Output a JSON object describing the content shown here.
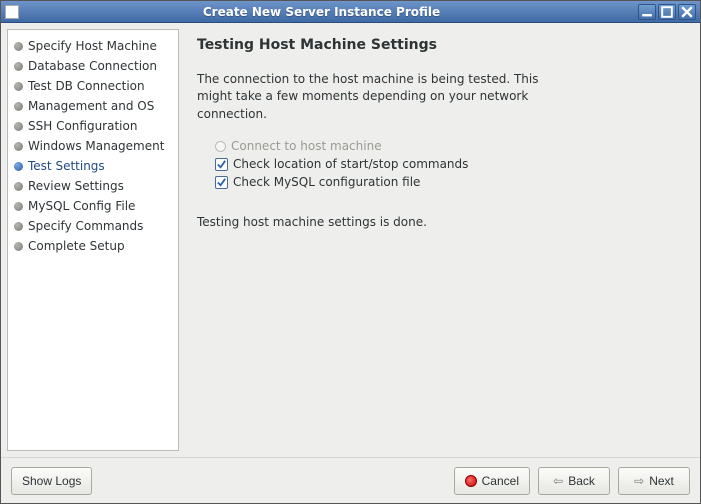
{
  "window": {
    "title": "Create New Server Instance Profile"
  },
  "sidebar": {
    "items": [
      {
        "label": "Specify Host Machine",
        "active": false
      },
      {
        "label": "Database Connection",
        "active": false
      },
      {
        "label": "Test DB Connection",
        "active": false
      },
      {
        "label": "Management and OS",
        "active": false
      },
      {
        "label": "SSH Configuration",
        "active": false
      },
      {
        "label": "Windows Management",
        "active": false
      },
      {
        "label": "Test Settings",
        "active": true
      },
      {
        "label": "Review Settings",
        "active": false
      },
      {
        "label": "MySQL Config File",
        "active": false
      },
      {
        "label": "Specify Commands",
        "active": false
      },
      {
        "label": "Complete Setup",
        "active": false
      }
    ]
  },
  "main": {
    "heading": "Testing Host Machine Settings",
    "description": "The connection to the host machine is being tested. This might take a few moments depending on your network connection.",
    "checks": [
      {
        "label": "Connect to host machine",
        "state": "disabled"
      },
      {
        "label": "Check location of start/stop commands",
        "state": "checked"
      },
      {
        "label": "Check MySQL configuration file",
        "state": "checked"
      }
    ],
    "status": "Testing host machine settings is done."
  },
  "footer": {
    "show_logs": "Show Logs",
    "cancel": "Cancel",
    "back": "Back",
    "next": "Next"
  }
}
